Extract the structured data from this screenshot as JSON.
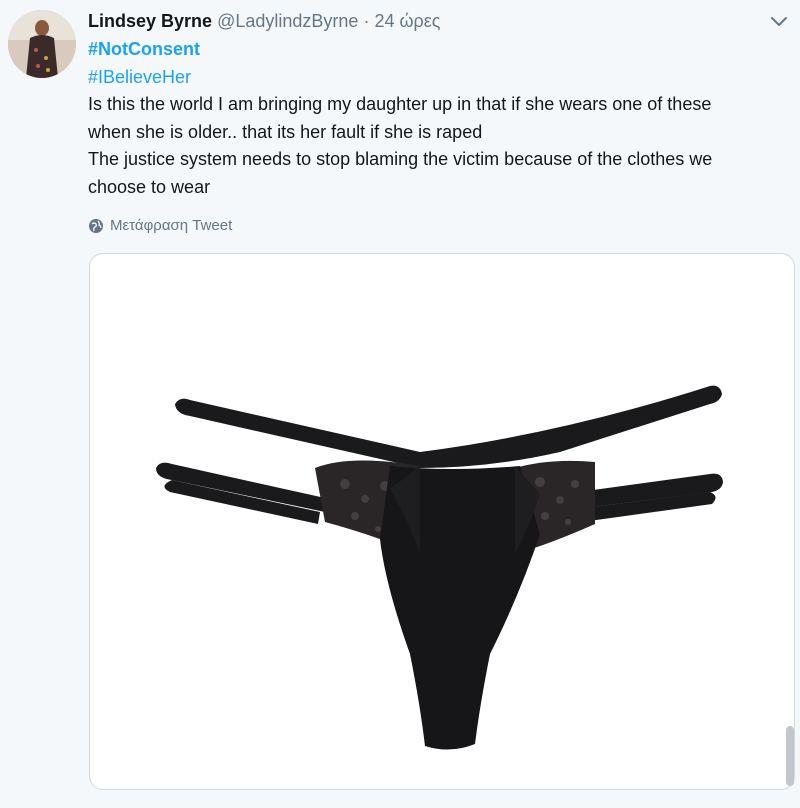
{
  "tweet": {
    "author_name": "Lindsey Byrne",
    "handle": "@LadylindzByrne",
    "separator": "·",
    "time": "24 ώρες",
    "hashtags": [
      "#NotConsent",
      "#IBelieveHer"
    ],
    "lines": [
      "Is this the world I am bringing my daughter up in that if she wears one of these",
      "when she is older.. that its her fault if she is raped",
      "The justice system needs to stop blaming the victim because of the clothes we",
      "choose to wear"
    ],
    "translate_label": "Μετάφραση Tweet"
  },
  "icons": {
    "menu": "chevron-down-icon",
    "translate": "globe-icon"
  },
  "colors": {
    "link": "#1da1f2",
    "secondary_text": "#657786",
    "background": "#f5f8fa",
    "card_border": "#cfd9de"
  }
}
